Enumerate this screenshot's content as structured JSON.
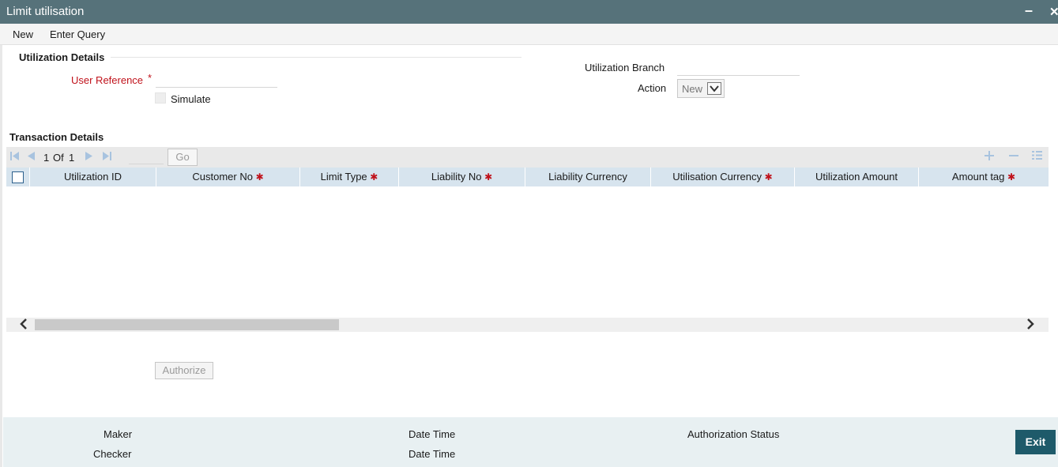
{
  "window": {
    "title": "Limit utilisation",
    "minimize_glyph": "–",
    "close_glyph": "✕"
  },
  "toolbar": {
    "new_label": "New",
    "enter_query_label": "Enter Query"
  },
  "utilization_details": {
    "section_title": "Utilization Details",
    "user_reference_label": "User Reference",
    "required_mark": "*",
    "user_reference_value": "",
    "simulate_label": "Simulate",
    "simulate_checked": false,
    "utilization_branch_label": "Utilization Branch",
    "utilization_branch_value": "",
    "action_label": "Action",
    "action_value": "New"
  },
  "transaction_details": {
    "section_title": "Transaction Details",
    "pagination": {
      "current": "1",
      "of_label": "Of",
      "total": "1",
      "go_label": "Go"
    },
    "icons": [
      "first-page-icon",
      "prev-page-icon",
      "next-page-icon",
      "last-page-icon",
      "add-row-icon",
      "delete-row-icon",
      "single-view-icon"
    ],
    "columns": [
      {
        "label": "Utilization ID",
        "required": false
      },
      {
        "label": "Customer No",
        "required": true
      },
      {
        "label": "Limit Type",
        "required": true
      },
      {
        "label": "Liability No",
        "required": true
      },
      {
        "label": "Liability Currency",
        "required": false
      },
      {
        "label": "Utilisation Currency",
        "required": true
      },
      {
        "label": "Utilization Amount",
        "required": false
      },
      {
        "label": "Amount tag",
        "required": true
      }
    ],
    "rows": []
  },
  "authorize_label": "Authorize",
  "footer": {
    "maker_label": "Maker",
    "checker_label": "Checker",
    "date_time_label_1": "Date Time",
    "date_time_label_2": "Date Time",
    "authorization_status_label": "Authorization Status",
    "exit_label": "Exit"
  },
  "colors": {
    "title_bar": "#56727a",
    "required": "#c0121b",
    "table_header": "#d7e4ee",
    "exit_button": "#1e5a6a",
    "footer": "#e8f0f2"
  }
}
